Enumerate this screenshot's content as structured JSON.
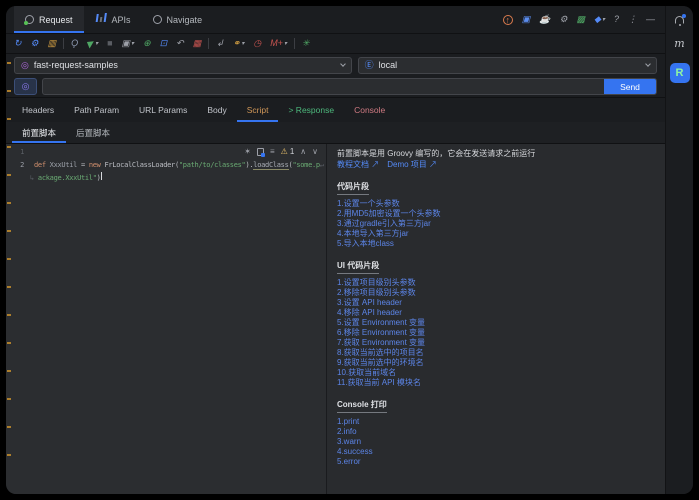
{
  "titlebar": {
    "tabs": [
      {
        "label": "Request"
      },
      {
        "label": "APIs"
      },
      {
        "label": "Navigate"
      }
    ],
    "actions": [
      {
        "name": "upgrade-icon",
        "glyph": "↑",
        "color": "#d97a4d",
        "arrow": ""
      },
      {
        "name": "ai-robot-icon",
        "glyph": "▣",
        "color": "#5b8def",
        "arrow": ""
      },
      {
        "name": "coffee-icon",
        "glyph": "☕",
        "color": "#c75c52",
        "arrow": ""
      },
      {
        "name": "settings-gear-icon",
        "glyph": "⚙",
        "color": "#9da0a8",
        "arrow": ""
      },
      {
        "name": "license-badge-icon",
        "glyph": "▩",
        "color": "#4fa764",
        "arrow": ""
      },
      {
        "name": "pro-gem-icon",
        "glyph": "◆",
        "color": "#548af7",
        "arrow": "▾"
      },
      {
        "name": "help-icon",
        "glyph": "?",
        "color": "#9da0a8",
        "arrow": ""
      },
      {
        "name": "more-options-icon",
        "glyph": "⋮",
        "color": "#9da0a8",
        "arrow": ""
      },
      {
        "name": "minimize-icon",
        "glyph": "—",
        "color": "#9da0a8",
        "arrow": ""
      }
    ]
  },
  "toolbar": {
    "groups": [
      [
        {
          "name": "sync-icon",
          "glyph": "↻",
          "color": "#548af7",
          "arrow": ""
        },
        {
          "name": "config-gear-icon",
          "glyph": "⚙",
          "color": "#548af7",
          "arrow": ""
        },
        {
          "name": "card-view-icon",
          "glyph": "▥",
          "color": "#d9a343",
          "arrow": ""
        }
      ],
      [
        {
          "name": "search-icon",
          "glyph": "Ϙ",
          "color": "#8f9bb3",
          "arrow": ""
        },
        {
          "name": "send-request-icon",
          "glyph": "▶",
          "color": "#4fa764",
          "arrow": "▾"
        },
        {
          "name": "stop-icon",
          "glyph": "■",
          "color": "#5a5d63",
          "arrow": ""
        },
        {
          "name": "save-icon",
          "glyph": "▣",
          "color": "#9da0a8",
          "arrow": "▾"
        },
        {
          "name": "locate-icon",
          "glyph": "⊕",
          "color": "#4fa764",
          "arrow": ""
        },
        {
          "name": "cube-icon",
          "glyph": "⊡",
          "color": "#548af7",
          "arrow": ""
        },
        {
          "name": "undo-icon",
          "glyph": "↶",
          "color": "#9da0a8",
          "arrow": ""
        },
        {
          "name": "clear-icon",
          "glyph": "▦",
          "color": "#c75450",
          "arrow": ""
        }
      ],
      [
        {
          "name": "import-icon",
          "glyph": "↲",
          "color": "#9da0a8",
          "arrow": ""
        },
        {
          "name": "link-icon",
          "glyph": "⚭",
          "color": "#d9a343",
          "arrow": "▾"
        },
        {
          "name": "history-clock-icon",
          "glyph": "◷",
          "color": "#c75450",
          "arrow": ""
        },
        {
          "name": "markdown-icon",
          "glyph": "M+",
          "color": "#c75450",
          "arrow": "▾"
        }
      ],
      [
        {
          "name": "burst-icon",
          "glyph": "✳",
          "color": "#4fa764",
          "arrow": ""
        }
      ]
    ]
  },
  "selectors": {
    "project": {
      "icon_glyph": "◎",
      "icon_color": "#b36ae2",
      "value": "fast-request-samples"
    },
    "environment": {
      "icon_glyph": "Ⓔ",
      "icon_color": "#548af7",
      "value": "local"
    }
  },
  "request_bar": {
    "method_icon_glyph": "◎",
    "method_icon_color": "#8f7cf5",
    "url_value": "",
    "send_label": "Send"
  },
  "request_tabs": [
    "Headers",
    "Path Param",
    "URL Params",
    "Body",
    "Script",
    "> Response",
    "Console"
  ],
  "script_tabs": [
    "前置脚本",
    "后置脚本"
  ],
  "editor": {
    "line1_number": "1",
    "line2_number": "2",
    "wrap_end_mark": "↵",
    "wrap_start_mark": "↳",
    "line2_segments": [
      {
        "t": "def ",
        "c": "#cf8e6d",
        "cls": ""
      },
      {
        "t": "XxxUtil ",
        "c": "#9da2aa",
        "cls": ""
      },
      {
        "t": "= ",
        "c": "#bcbec4",
        "cls": ""
      },
      {
        "t": "new ",
        "c": "#cf8e6d",
        "cls": ""
      },
      {
        "t": "FrLocalClassLoader(",
        "c": "#bcbec4",
        "cls": ""
      },
      {
        "t": "\"path/to/classes\"",
        "c": "#6aab73",
        "cls": ""
      },
      {
        "t": ").",
        "c": "#bcbec4",
        "cls": ""
      },
      {
        "t": "loadClass",
        "c": "#a9adb5",
        "cls": "unres"
      },
      {
        "t": "(",
        "c": "#bcbec4",
        "cls": ""
      },
      {
        "t": "\"some.p",
        "c": "#6aab73",
        "cls": ""
      }
    ],
    "wrap_segments": [
      {
        "t": "ackage.XxxUtil\"",
        "c": "#6aab73",
        "cls": ""
      },
      {
        "t": ")",
        "c": "#bcbec4",
        "cls": ""
      }
    ],
    "toolbar": {
      "ai_wand_glyph": "✶",
      "wrap_lines_glyph": "≡",
      "warning_glyph": "⚠",
      "warning_count": "1",
      "prev_glyph": "∧",
      "next_glyph": "∨"
    }
  },
  "help": {
    "intro": "前置脚本是用 Groovy 编写的，它会在发送请求之前运行",
    "links": [
      "教程文档 ↗",
      "Demo 项目 ↗"
    ],
    "sections": [
      {
        "title": "代码片段",
        "items": [
          "1.设置一个头参数",
          "2.用MD5加密设置一个头参数",
          "3.通过gradle引入第三方jar",
          "4.本地导入第三方jar",
          "5.导入本地class"
        ]
      },
      {
        "title": "UI 代码片段",
        "items": [
          "1.设置项目级别头参数",
          "2.移除项目级别头参数",
          "3.设置 API header",
          "4.移除 API header",
          "5.设置 Environment 变量",
          "6.移除 Environment 变量",
          "7.获取 Environment 变量",
          "8.获取当前选中的项目名",
          "9.获取当前选中的环境名",
          "10.获取当前域名",
          "11.获取当前 API 模块名"
        ]
      },
      {
        "title": "Console 打印",
        "items": [
          "1.print",
          "2.info",
          "3.warn",
          "4.success",
          "5.error"
        ]
      }
    ]
  },
  "stripe": {
    "maven_label": "m",
    "fast_request_label": "R"
  }
}
